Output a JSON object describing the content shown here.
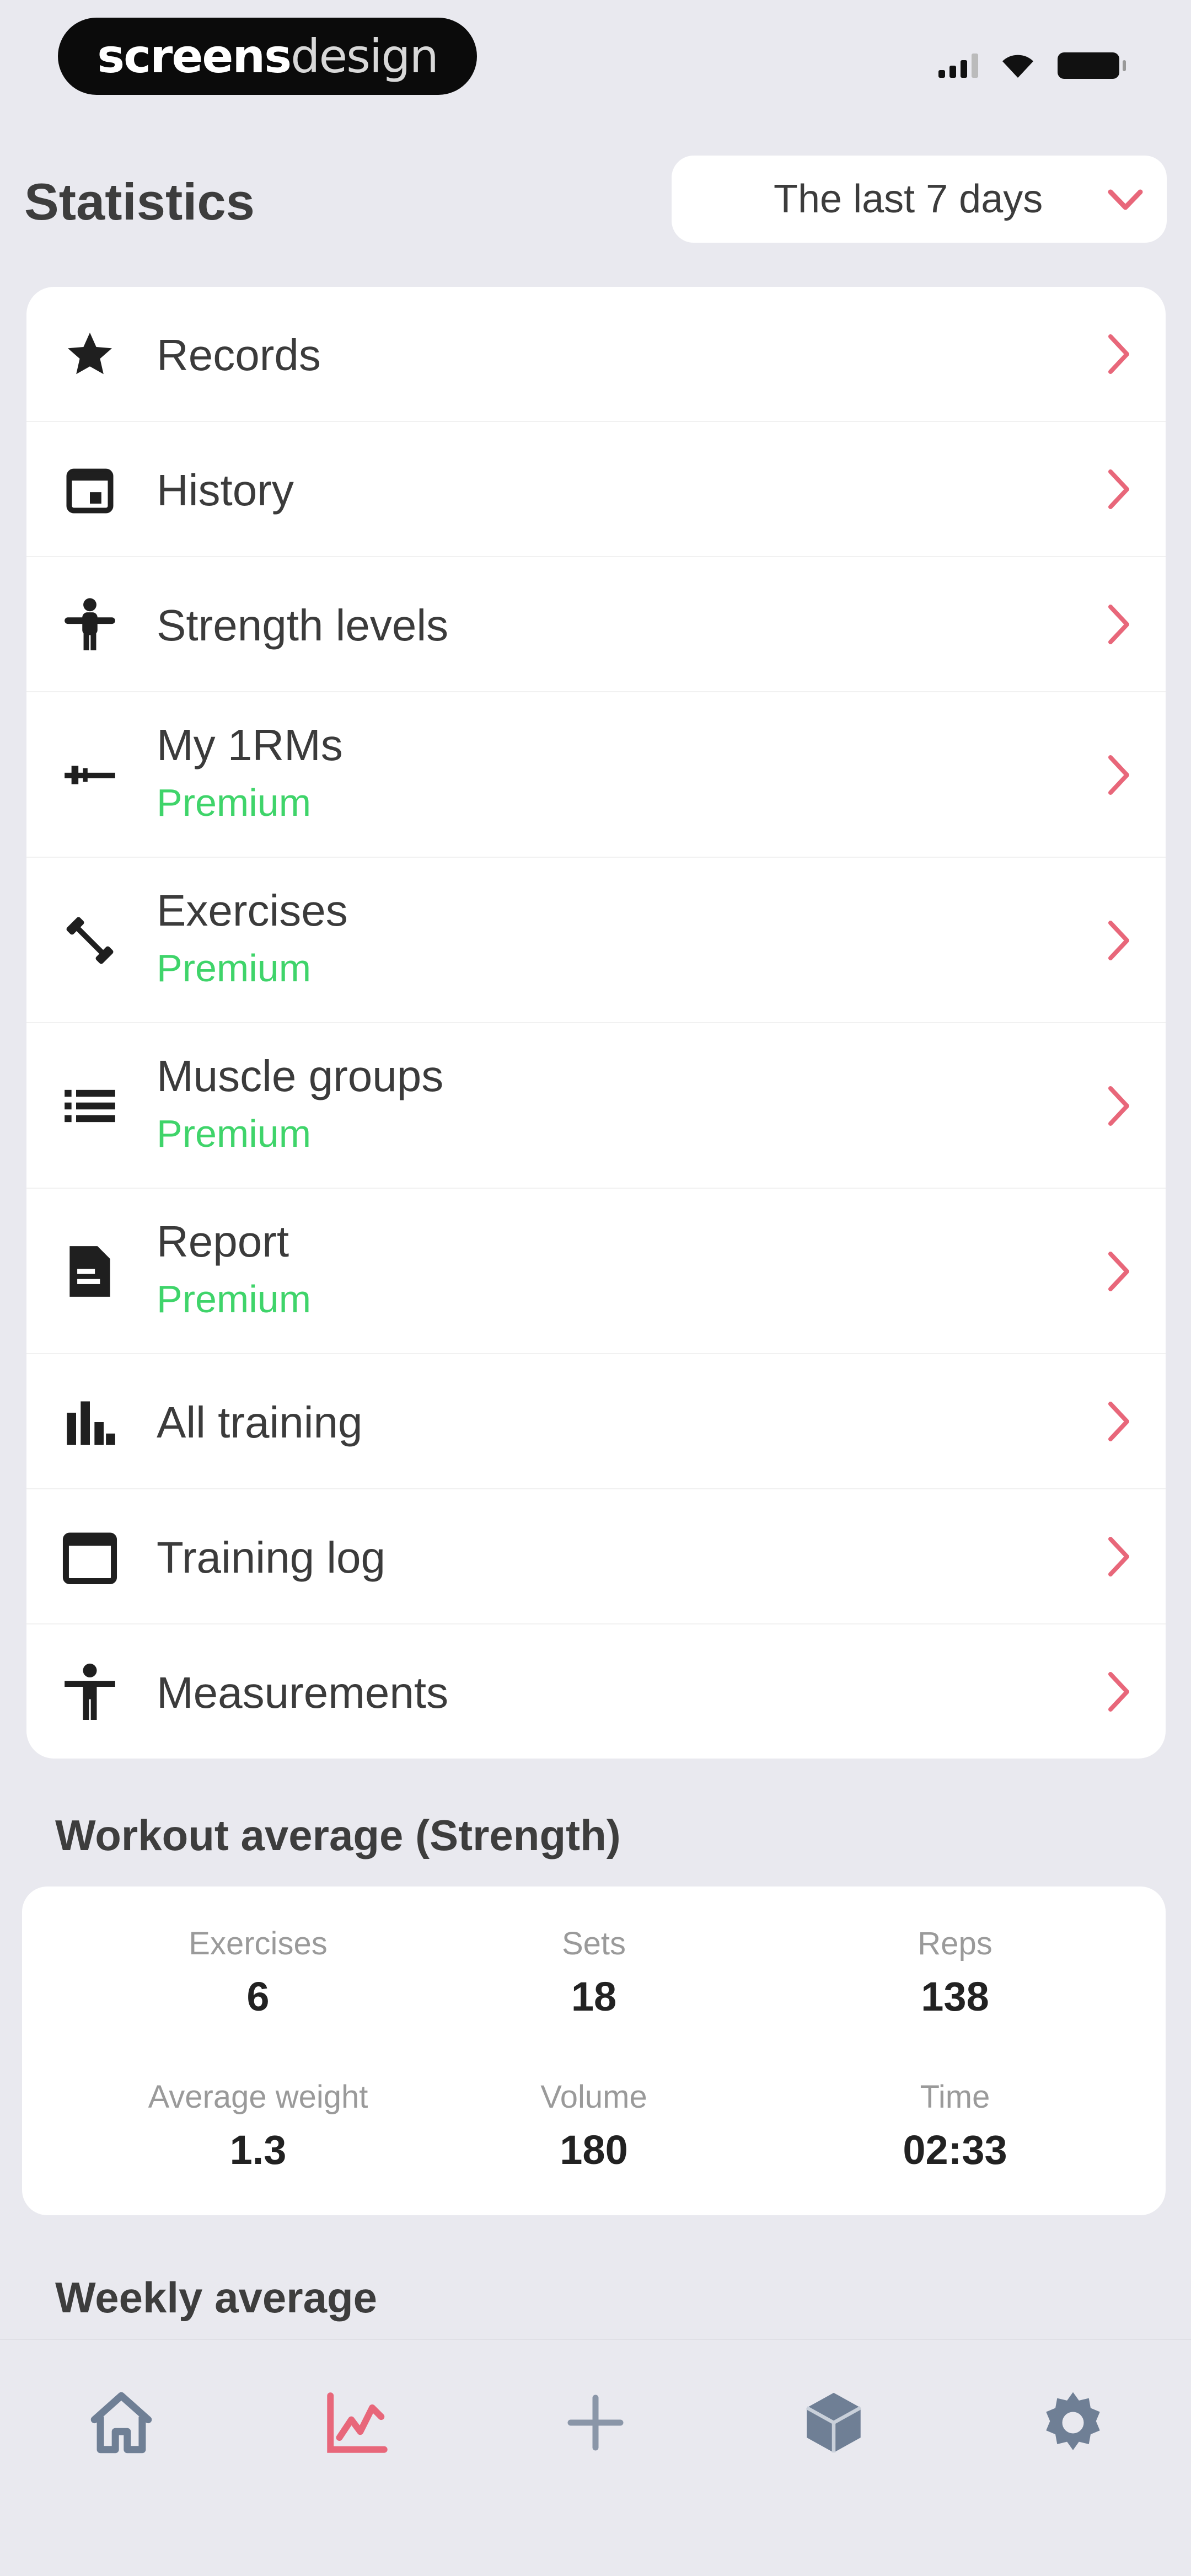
{
  "status_bar": {
    "brand_part1": "screens",
    "brand_part2": "design"
  },
  "header": {
    "title": "Statistics",
    "range_select": {
      "value": "The last 7 days",
      "icon": "chevron-down-icon"
    }
  },
  "menu": {
    "items": [
      {
        "label": "Records",
        "icon": "star-icon"
      },
      {
        "label": "History",
        "icon": "calendar-day-icon"
      },
      {
        "label": "Strength levels",
        "icon": "strength-figure-icon"
      },
      {
        "label": "My 1RMs",
        "sub": "Premium",
        "icon": "barbell-icon"
      },
      {
        "label": "Exercises",
        "sub": "Premium",
        "icon": "dumbbell-icon"
      },
      {
        "label": "Muscle groups",
        "sub": "Premium",
        "icon": "list-icon"
      },
      {
        "label": "Report",
        "sub": "Premium",
        "icon": "document-icon"
      },
      {
        "label": "All training",
        "icon": "bar-chart-icon"
      },
      {
        "label": "Training log",
        "icon": "calendar-icon"
      },
      {
        "label": "Measurements",
        "icon": "body-icon"
      }
    ],
    "chevron_icon": "chevron-right-icon"
  },
  "workout_average": {
    "title": "Workout average (Strength)",
    "stats": [
      {
        "label": "Exercises",
        "value": "6"
      },
      {
        "label": "Sets",
        "value": "18"
      },
      {
        "label": "Reps",
        "value": "138"
      },
      {
        "label": "Average weight",
        "value": "1.3"
      },
      {
        "label": "Volume",
        "value": "180"
      },
      {
        "label": "Time",
        "value": "02:33"
      }
    ]
  },
  "weekly_average": {
    "title": "Weekly average"
  },
  "tab_bar": {
    "tabs": [
      {
        "name": "home",
        "icon": "home-icon"
      },
      {
        "name": "statistics",
        "icon": "chart-icon",
        "active": true
      },
      {
        "name": "add",
        "icon": "plus-icon"
      },
      {
        "name": "workouts",
        "icon": "cube-icon"
      },
      {
        "name": "settings",
        "icon": "gear-icon"
      }
    ]
  },
  "colors": {
    "accent": "#e8677a",
    "premium": "#3fd46a",
    "background": "#e9e9ef",
    "icon_inactive": "#6f7f95"
  }
}
